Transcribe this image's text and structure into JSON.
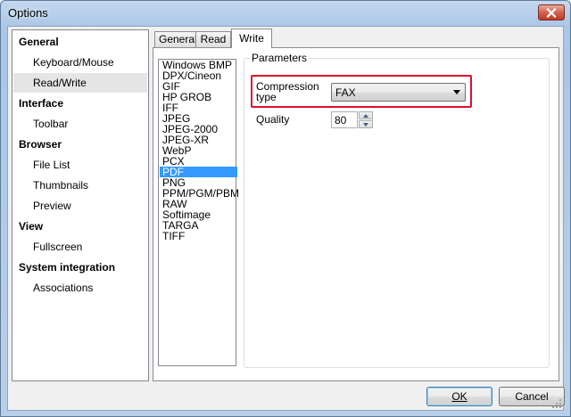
{
  "window": {
    "title": "Options"
  },
  "nav": {
    "items": [
      {
        "label": "General",
        "kind": "group"
      },
      {
        "label": "Keyboard/Mouse",
        "kind": "child"
      },
      {
        "label": "Read/Write",
        "kind": "child",
        "selected": true
      },
      {
        "label": "Interface",
        "kind": "group"
      },
      {
        "label": "Toolbar",
        "kind": "child"
      },
      {
        "label": "Browser",
        "kind": "group"
      },
      {
        "label": "File List",
        "kind": "child"
      },
      {
        "label": "Thumbnails",
        "kind": "child"
      },
      {
        "label": "Preview",
        "kind": "child"
      },
      {
        "label": "View",
        "kind": "group"
      },
      {
        "label": "Fullscreen",
        "kind": "child"
      },
      {
        "label": "System integration",
        "kind": "group"
      },
      {
        "label": "Associations",
        "kind": "child"
      }
    ]
  },
  "tabs": [
    {
      "label": "General"
    },
    {
      "label": "Read"
    },
    {
      "label": "Write",
      "active": true
    }
  ],
  "formats": [
    "Windows BMP",
    "DPX/Cineon",
    "GIF",
    "HP GROB",
    "IFF",
    "JPEG",
    "JPEG-2000",
    "JPEG-XR",
    "WebP",
    "PCX",
    "PDF",
    "PNG",
    "PPM/PGM/PBM",
    "RAW",
    "Softimage",
    "TARGA",
    "TIFF"
  ],
  "selected_format": "PDF",
  "params": {
    "legend": "Parameters",
    "compression_label_line1": "Compression",
    "compression_label_line2": "type",
    "compression_value": "FAX",
    "quality_label": "Quality",
    "quality_value": "80"
  },
  "buttons": {
    "ok": "OK",
    "cancel": "Cancel"
  },
  "colors": {
    "highlight": "#e0102a",
    "selection": "#3399ff"
  }
}
